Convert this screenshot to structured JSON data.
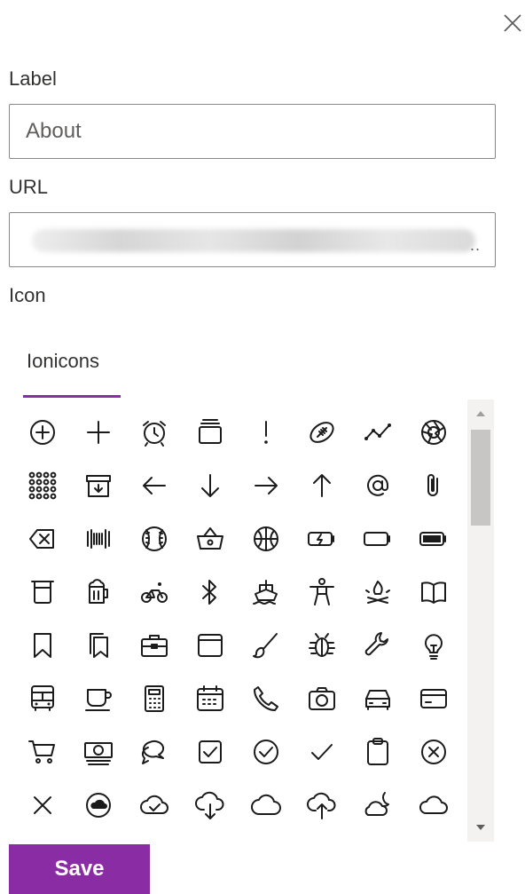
{
  "dialog": {
    "close_icon": "close-icon",
    "label_field": {
      "label": "Label",
      "value": "About"
    },
    "url_field": {
      "label": "URL",
      "value": "",
      "truncation": ".."
    },
    "icon_section": {
      "label": "Icon"
    },
    "tabs": [
      {
        "label": "Ionicons",
        "selected": true
      }
    ],
    "icons": [
      "add-circle-icon",
      "add-icon",
      "alarm-icon",
      "albums-icon",
      "alert-icon",
      "american-football-icon",
      "analytics-icon",
      "aperture-icon",
      "apps-icon",
      "archive-icon",
      "arrow-back-icon",
      "arrow-down-icon",
      "arrow-forward-icon",
      "arrow-up-icon",
      "at-icon",
      "attach-icon",
      "backspace-icon",
      "barcode-icon",
      "baseball-icon",
      "basket-icon",
      "basketball-icon",
      "battery-charging-icon",
      "battery-dead-icon",
      "battery-full-icon",
      "beaker-icon",
      "beer-icon",
      "bicycle-icon",
      "bluetooth-icon",
      "boat-icon",
      "body-icon",
      "bonfire-icon",
      "book-icon",
      "bookmark-icon",
      "bookmarks-icon",
      "briefcase-icon",
      "browsers-icon",
      "brush-icon",
      "bug-icon",
      "build-icon",
      "bulb-icon",
      "bus-icon",
      "cafe-icon",
      "calculator-icon",
      "calendar-icon",
      "call-icon",
      "camera-icon",
      "car-icon",
      "card-icon",
      "cart-icon",
      "cash-icon",
      "chatbubbles-icon",
      "checkbox-icon",
      "checkmark-circle-icon",
      "checkmark-icon",
      "clipboard-icon",
      "close-circle-icon",
      "close-icon",
      "cloud-circle-icon",
      "cloud-done-icon",
      "cloud-download-icon",
      "cloud-icon",
      "cloud-upload-icon",
      "cloudy-night-icon",
      "cloud-outline-icon"
    ],
    "scrollbar": {
      "position": 0
    },
    "save_label": "Save",
    "accent": "#8a2da5"
  }
}
